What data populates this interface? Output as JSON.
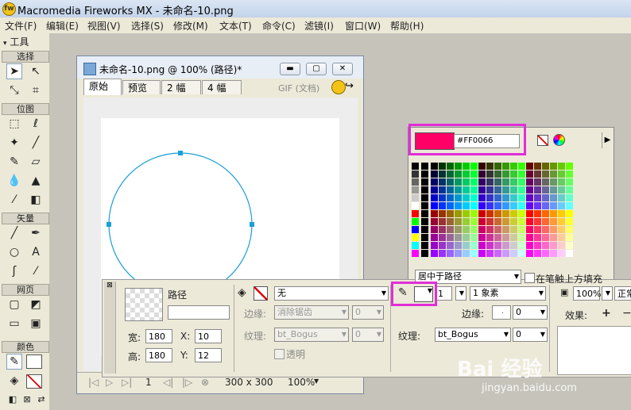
{
  "window": {
    "title": "Macromedia Fireworks MX - 未命名-10.png"
  },
  "menu": [
    "文件(F)",
    "编辑(E)",
    "视图(V)",
    "选择(S)",
    "修改(M)",
    "文本(T)",
    "命令(C)",
    "滤镜(I)",
    "窗口(W)",
    "帮助(H)"
  ],
  "tools": {
    "header": "工具",
    "sections": {
      "select": "选择",
      "bitmap": "位图",
      "vector": "矢量",
      "web": "网页",
      "colors": "颜色"
    }
  },
  "document": {
    "title": "未命名-10.png @ 100% (路径)*",
    "tabs": [
      "原始",
      "预览",
      "2 幅",
      "4 幅"
    ],
    "format_label": "GIF (文档)",
    "status": {
      "frame": "1",
      "size": "300 x 300",
      "zoom": "100%"
    }
  },
  "swatches": {
    "hex": "#FF0066",
    "selected_color": "#FF0066"
  },
  "properties": {
    "object_label": "路径",
    "width_label": "宽:",
    "width": "180",
    "height_label": "高:",
    "height": "180",
    "x_label": "X:",
    "x": "10",
    "y_label": "Y:",
    "y": "12",
    "fill": {
      "value": "无",
      "edge_label": "边缘:",
      "edge": "消除锯齿",
      "edge_amount": "0",
      "texture_label": "纹理:",
      "texture": "bt_Bogus",
      "texture_amount": "0",
      "transparent_label": "透明"
    },
    "stroke": {
      "size": "1",
      "type": "1 象素",
      "position": "居中于路径",
      "fill_over_label": "在笔触上方填充",
      "edge_label": "边缘:",
      "edge_amount": "0",
      "texture_label": "纹理:",
      "texture": "bt_Bogus",
      "texture_amount": "0"
    },
    "opacity": "100%",
    "blend": "正常",
    "effects_label": "效果:"
  },
  "watermark": {
    "brand": "Bai 经验",
    "url": "jingyan.baidu.com"
  },
  "colors": {
    "highlight": "#e12ed6",
    "circle": "#1a9fd6",
    "accent": "#FF0066"
  }
}
